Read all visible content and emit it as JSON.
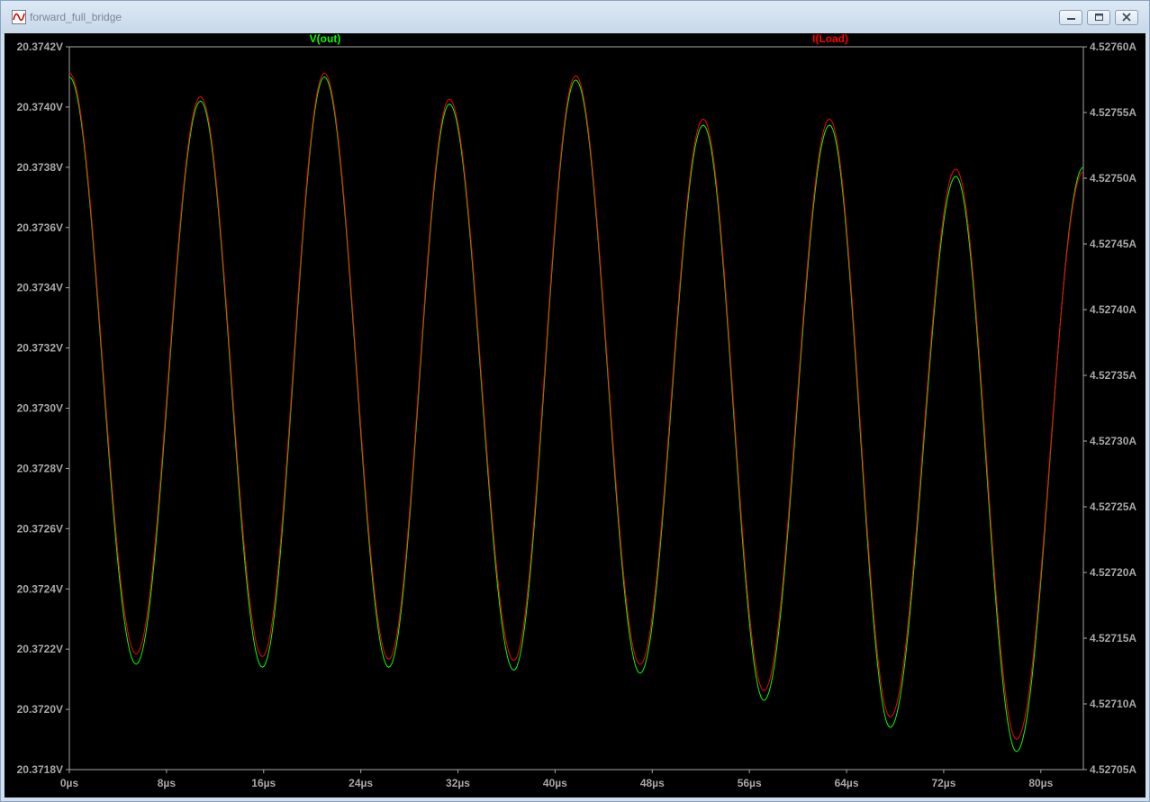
{
  "window": {
    "title": "forward_full_bridge",
    "icon": "waveform-icon",
    "buttons": [
      "minimize",
      "restore",
      "close"
    ]
  },
  "chart_data": {
    "type": "line",
    "traces": [
      {
        "name": "V(out)",
        "color": "#00ff00",
        "axis": "left"
      },
      {
        "name": "I(Load)",
        "color": "#ff0000",
        "axis": "right"
      }
    ],
    "x_axis": {
      "unit": "µs",
      "range": [
        0,
        83.5
      ],
      "ticks": [
        "0µs",
        "8µs",
        "16µs",
        "24µs",
        "32µs",
        "40µs",
        "48µs",
        "56µs",
        "64µs",
        "72µs",
        "80µs"
      ]
    },
    "y_left": {
      "unit": "V",
      "range": [
        20.3718,
        20.3742
      ],
      "ticks": [
        "20.3742V",
        "20.3740V",
        "20.3738V",
        "20.3736V",
        "20.3734V",
        "20.3732V",
        "20.3730V",
        "20.3728V",
        "20.3726V",
        "20.3724V",
        "20.3722V",
        "20.3720V",
        "20.3718V"
      ]
    },
    "y_right": {
      "unit": "A",
      "range": [
        4.52705,
        4.5276
      ],
      "ticks": [
        "4.52760A",
        "4.52755A",
        "4.52750A",
        "4.52745A",
        "4.52740A",
        "4.52735A",
        "4.52730A",
        "4.52725A",
        "4.52720A",
        "4.52715A",
        "4.52710A",
        "4.52705A"
      ]
    },
    "extrema_v": [
      {
        "t": 0.0,
        "v": 20.3741
      },
      {
        "t": 5.5,
        "v": 20.37215
      },
      {
        "t": 10.8,
        "v": 20.37402
      },
      {
        "t": 15.9,
        "v": 20.37214
      },
      {
        "t": 21.0,
        "v": 20.3741
      },
      {
        "t": 26.3,
        "v": 20.37214
      },
      {
        "t": 31.3,
        "v": 20.37401
      },
      {
        "t": 36.6,
        "v": 20.37213
      },
      {
        "t": 41.7,
        "v": 20.37409
      },
      {
        "t": 47.0,
        "v": 20.37212
      },
      {
        "t": 52.2,
        "v": 20.37394
      },
      {
        "t": 57.2,
        "v": 20.37203
      },
      {
        "t": 62.6,
        "v": 20.37394
      },
      {
        "t": 67.6,
        "v": 20.37194
      },
      {
        "t": 73.0,
        "v": 20.37377
      },
      {
        "t": 78.0,
        "v": 20.37186
      },
      {
        "t": 83.5,
        "v": 20.3738
      }
    ],
    "extrema_i": [
      {
        "t": 0.0,
        "i": 4.52758
      },
      {
        "t": 5.5,
        "i": 4.527138
      },
      {
        "t": 10.8,
        "i": 4.527562
      },
      {
        "t": 15.9,
        "i": 4.527136
      },
      {
        "t": 21.0,
        "i": 4.52758
      },
      {
        "t": 26.3,
        "i": 4.527134
      },
      {
        "t": 31.3,
        "i": 4.52756
      },
      {
        "t": 36.6,
        "i": 4.527133
      },
      {
        "t": 41.7,
        "i": 4.527578
      },
      {
        "t": 47.0,
        "i": 4.52713
      },
      {
        "t": 52.2,
        "i": 4.527545
      },
      {
        "t": 57.2,
        "i": 4.52711
      },
      {
        "t": 62.6,
        "i": 4.527545
      },
      {
        "t": 67.6,
        "i": 4.52709
      },
      {
        "t": 73.0,
        "i": 4.527507
      },
      {
        "t": 78.0,
        "i": 4.527073
      },
      {
        "t": 83.5,
        "i": 4.527505
      }
    ]
  }
}
